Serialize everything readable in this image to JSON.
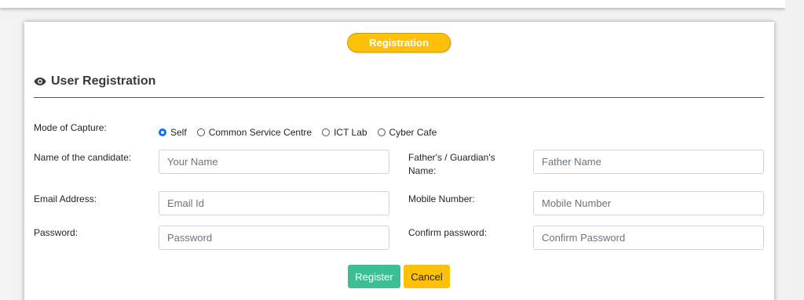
{
  "banner": {
    "label": "Registration"
  },
  "section": {
    "title": "User Registration",
    "icon": "eye-icon"
  },
  "mode": {
    "label": "Mode of Capture:",
    "options": [
      "Self",
      "Common Service Centre",
      "ICT Lab",
      "Cyber Cafe"
    ],
    "selected": "Self"
  },
  "fields": {
    "name": {
      "label": "Name of the candidate:",
      "placeholder": "Your Name"
    },
    "father": {
      "label_line1": "Father's / Guardian's",
      "label_line2": "Name:",
      "placeholder": "Father Name"
    },
    "email": {
      "label": "Email Address:",
      "placeholder": "Email Id"
    },
    "mobile": {
      "label": "Mobile Number:",
      "placeholder": "Mobile Number"
    },
    "password": {
      "label": "Password:",
      "placeholder": "Password"
    },
    "confirm": {
      "label": "Confirm password:",
      "placeholder": "Confirm Password"
    }
  },
  "buttons": {
    "register": "Register",
    "cancel": "Cancel"
  },
  "colors": {
    "accent": "#ffc107",
    "register": "#3cbf96",
    "radio_checked": "#0d6efd"
  }
}
